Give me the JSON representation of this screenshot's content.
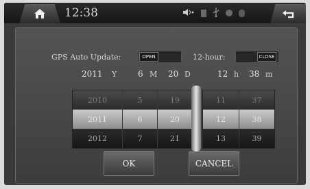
{
  "status_bar": {
    "time": "12:38",
    "icons": [
      "home-icon",
      "volume-icon",
      "sd-card-icon",
      "usb-icon",
      "gps-icon",
      "bluetooth-icon",
      "back-icon"
    ]
  },
  "settings": {
    "gps_auto_update_label": "GPS Auto Update:",
    "gps_auto_update_value": "OPEN",
    "hour_format_label": "12-hour:",
    "hour_format_value": "CLOSE"
  },
  "current": {
    "year": "2011",
    "year_unit": "Y",
    "month": "6",
    "month_unit": "M",
    "day": "20",
    "day_unit": "D",
    "hour": "12",
    "hour_unit": "h",
    "minute": "38",
    "minute_unit": "m"
  },
  "picker": {
    "year": [
      "2010",
      "2011",
      "2012"
    ],
    "month": [
      "5",
      "6",
      "7"
    ],
    "day": [
      "19",
      "20",
      "21"
    ],
    "hour": [
      "11",
      "12",
      "13"
    ],
    "minute": [
      "37",
      "38",
      "39"
    ]
  },
  "buttons": {
    "ok": "OK",
    "cancel": "CANCEL"
  }
}
